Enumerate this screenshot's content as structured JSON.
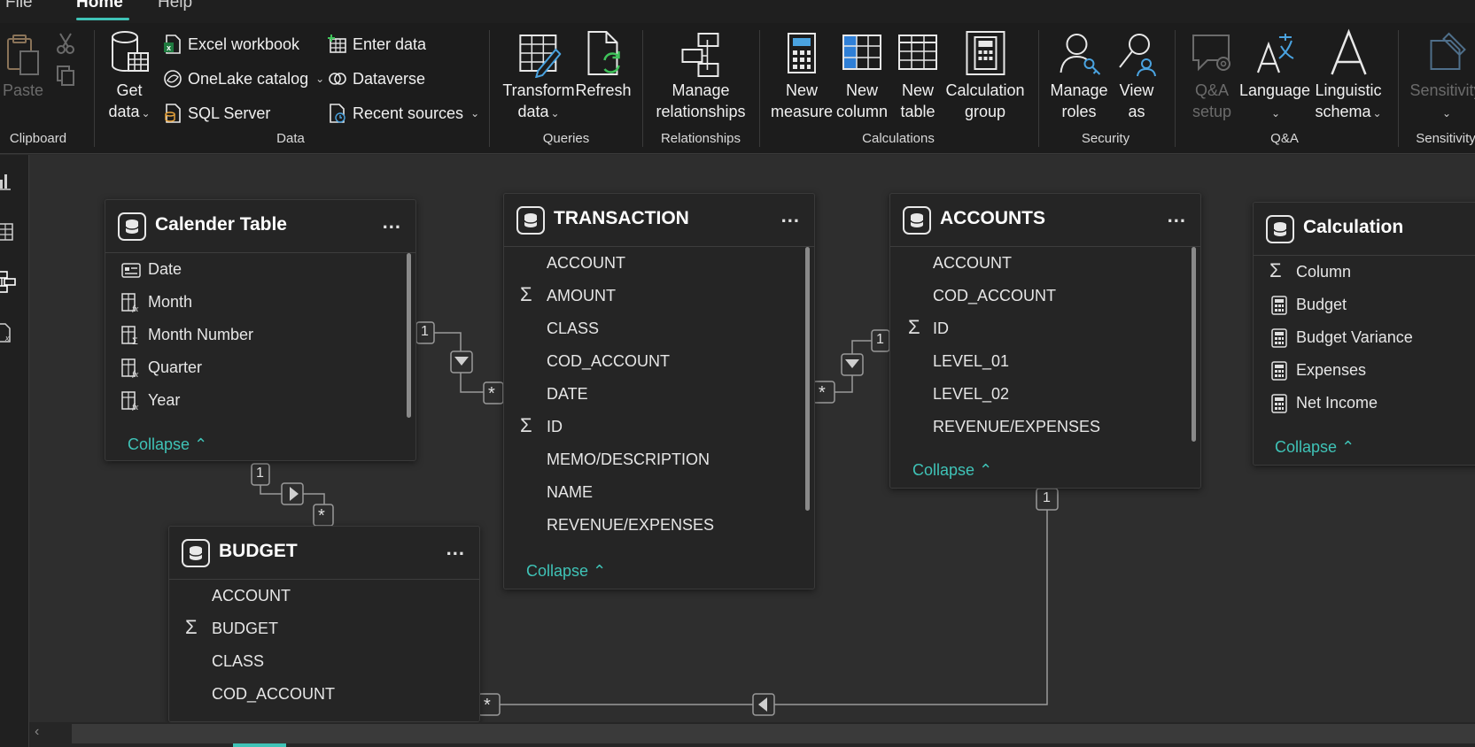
{
  "menu": {
    "file": "File",
    "home": "Home",
    "help": "Help"
  },
  "ribbon": {
    "clipboard": {
      "paste": "Paste",
      "group": "Clipboard"
    },
    "data": {
      "get_data_line1": "Get",
      "get_data_line2": "data",
      "excel": "Excel workbook",
      "onelake": "OneLake catalog",
      "sql": "SQL Server",
      "enter_data": "Enter data",
      "dataverse": "Dataverse",
      "recent_sources": "Recent sources",
      "group": "Data"
    },
    "queries": {
      "transform_line1": "Transform",
      "transform_line2": "data",
      "refresh": "Refresh",
      "group": "Queries"
    },
    "relationships": {
      "manage_line1": "Manage",
      "manage_line2": "relationships",
      "group": "Relationships"
    },
    "calculations": {
      "new_measure_line1": "New",
      "new_measure_line2": "measure",
      "new_column_line1": "New",
      "new_column_line2": "column",
      "new_table_line1": "New",
      "new_table_line2": "table",
      "calc_group_line1": "Calculation",
      "calc_group_line2": "group",
      "group": "Calculations"
    },
    "security": {
      "manage_roles_line1": "Manage",
      "manage_roles_line2": "roles",
      "view_as_line1": "View",
      "view_as_line2": "as",
      "group": "Security"
    },
    "qa": {
      "qa_setup_line1": "Q&A",
      "qa_setup_line2": "setup",
      "language": "Language",
      "linguistic_line1": "Linguistic",
      "linguistic_line2": "schema",
      "group": "Q&A"
    },
    "sensitivity": {
      "label": "Sensitivity",
      "group": "Sensitivity"
    }
  },
  "tables": {
    "calender": {
      "title": "Calender Table",
      "fields": [
        "Date",
        "Month",
        "Month Number",
        "Quarter",
        "Year"
      ],
      "collapse": "Collapse"
    },
    "transaction": {
      "title": "TRANSACTION",
      "fields": [
        "ACCOUNT",
        "AMOUNT",
        "CLASS",
        "COD_ACCOUNT",
        "DATE",
        "ID",
        "MEMO/DESCRIPTION",
        "NAME",
        "REVENUE/EXPENSES"
      ],
      "collapse": "Collapse"
    },
    "accounts": {
      "title": "ACCOUNTS",
      "fields": [
        "ACCOUNT",
        "COD_ACCOUNT",
        "ID",
        "LEVEL_01",
        "LEVEL_02",
        "REVENUE/EXPENSES"
      ],
      "collapse": "Collapse"
    },
    "calculation": {
      "title": "Calculation",
      "fields": [
        "Column",
        "Budget",
        "Budget Variance",
        "Expenses",
        "Net Income"
      ],
      "collapse": "Collapse"
    },
    "budget": {
      "title": "BUDGET",
      "fields": [
        "ACCOUNT",
        "BUDGET",
        "CLASS",
        "COD_ACCOUNT"
      ]
    }
  },
  "relationship_labels": {
    "one": "1",
    "many": "*"
  },
  "more_label": "...",
  "colors": {
    "accent": "#3fc3b7",
    "canvas": "#2e2e2e",
    "card": "#252525",
    "ribbon": "#1c1c1c"
  }
}
